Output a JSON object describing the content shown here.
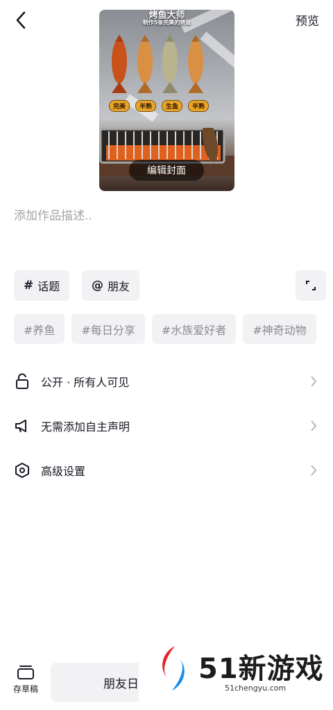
{
  "header": {
    "back_icon": "chevron-left-icon",
    "preview_label": "预览"
  },
  "cover": {
    "game_title": "烤鱼大师",
    "subtitle": "制作5条完美的烤鱼",
    "fish_tags": [
      "完美",
      "半熟",
      "生鱼",
      "半熟"
    ],
    "edit_label": "编辑封面"
  },
  "description": {
    "placeholder": "添加作品描述.."
  },
  "chips": {
    "topic_symbol": "#",
    "topic_label": "话题",
    "friend_symbol": "@",
    "friend_label": "朋友",
    "expand_icon": "expand-corners-icon"
  },
  "suggested_tags": [
    "#养鱼",
    "#每日分享",
    "#水族爱好者",
    "#神奇动物"
  ],
  "settings": [
    {
      "icon": "lock-icon",
      "label": "公开 · 所有人可见"
    },
    {
      "icon": "megaphone-icon",
      "label": "无需添加自主声明"
    },
    {
      "icon": "hexagon-settings-icon",
      "label": "高级设置"
    }
  ],
  "bottom": {
    "draft_label": "存草稿",
    "friend_button_label": "朋友日"
  },
  "watermark": {
    "brand": "51新游戏",
    "url": "51chengyu.com"
  }
}
